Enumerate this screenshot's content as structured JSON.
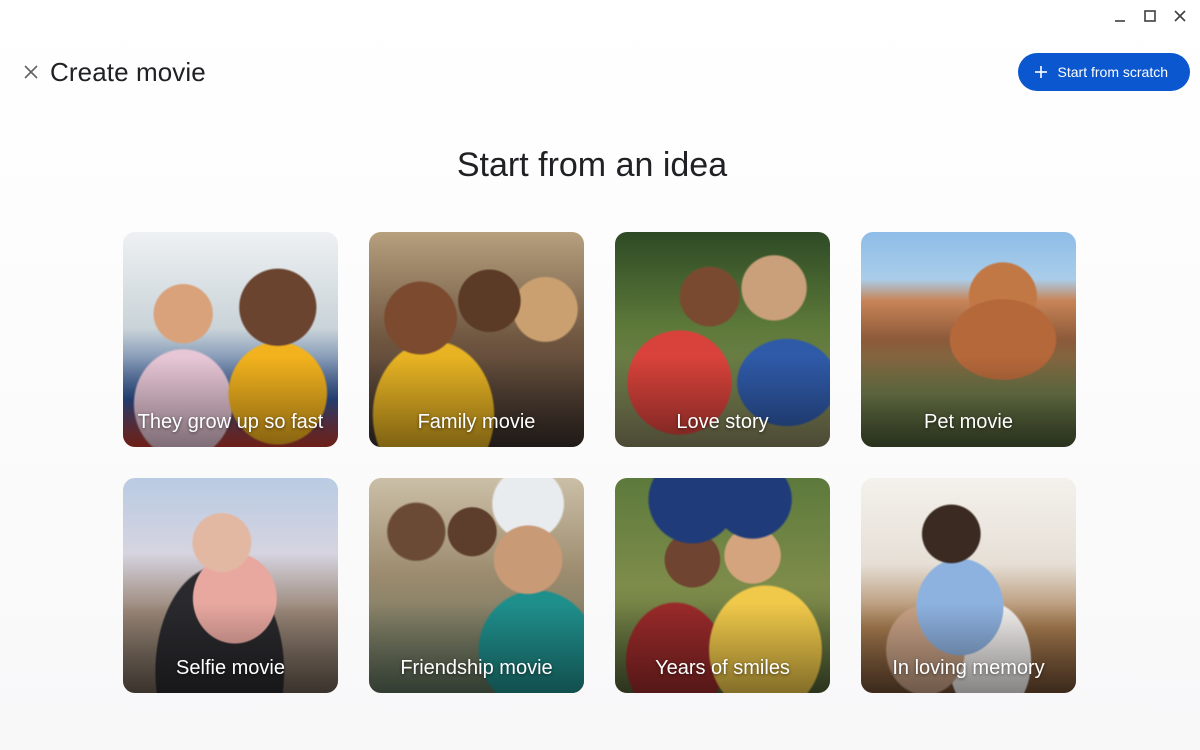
{
  "window": {
    "controls": [
      "minimize-icon",
      "maximize-icon",
      "close-icon"
    ]
  },
  "header": {
    "close_icon": "close-icon",
    "title": "Create movie",
    "start_button": {
      "label": "Start from scratch",
      "icon": "plus-icon",
      "color": "#0b57d0"
    }
  },
  "section": {
    "title": "Start from an idea"
  },
  "ideas": [
    {
      "label": "They grow up so fast"
    },
    {
      "label": "Family movie"
    },
    {
      "label": "Love story"
    },
    {
      "label": "Pet movie"
    },
    {
      "label": "Selfie movie"
    },
    {
      "label": "Friendship movie"
    },
    {
      "label": "Years of smiles"
    },
    {
      "label": "In loving memory"
    }
  ]
}
